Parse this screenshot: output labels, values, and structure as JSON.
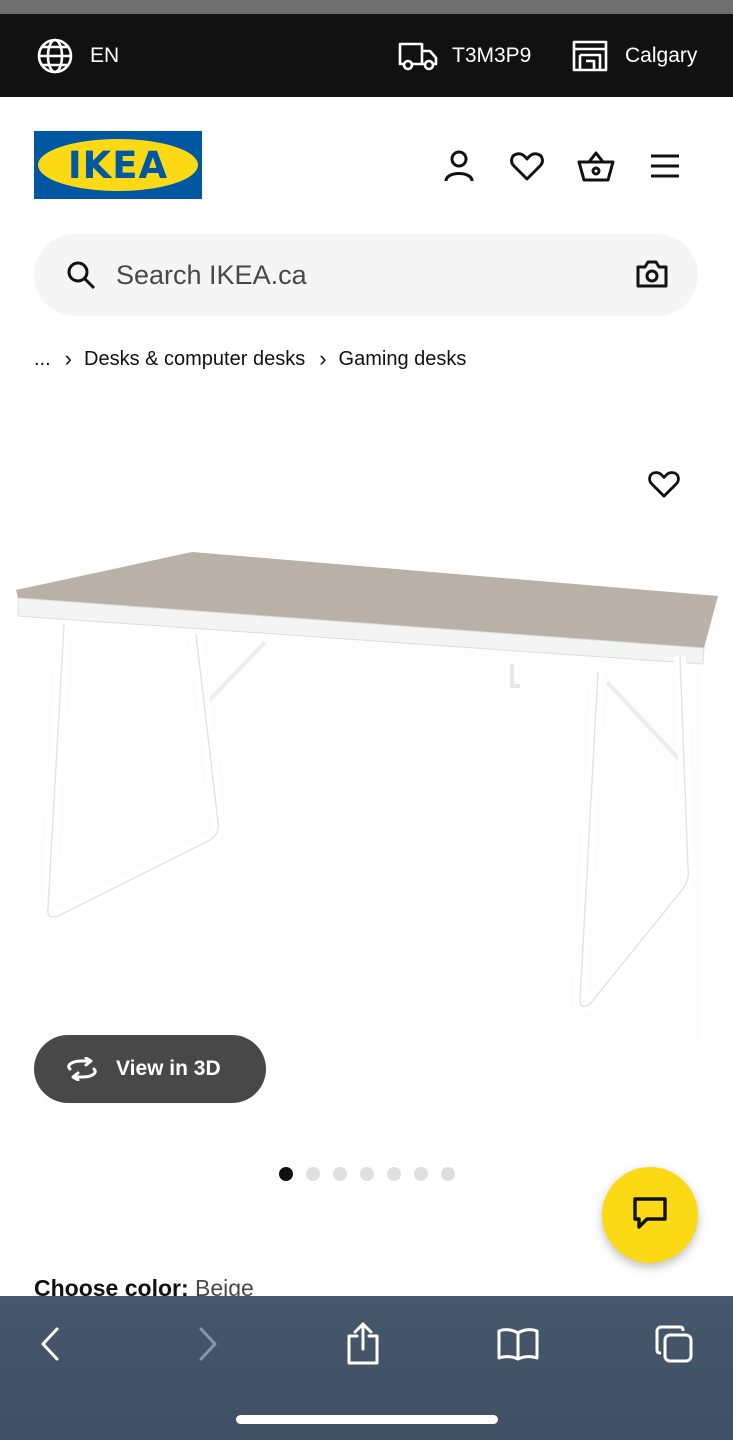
{
  "topbar": {
    "language": "EN",
    "postal_code": "T3M3P9",
    "store": "Calgary"
  },
  "header": {
    "logo_text": "IKEA"
  },
  "search": {
    "placeholder": "Search IKEA.ca"
  },
  "breadcrumb": {
    "items": [
      "...",
      "Desks & computer desks",
      "Gaming desks"
    ]
  },
  "product": {
    "view3d_label": "View in 3D",
    "image_count": 7,
    "active_image": 1,
    "choose_color_label": "Choose color:",
    "color_value": "Beige"
  },
  "colors": {
    "brand_blue": "#0058a3",
    "brand_yellow": "#fbd914",
    "desk_top": "#b8b0a6"
  },
  "browser_toolbar": {
    "icons": [
      "back-icon",
      "forward-icon",
      "share-icon",
      "bookmarks-icon",
      "tabs-icon"
    ]
  }
}
